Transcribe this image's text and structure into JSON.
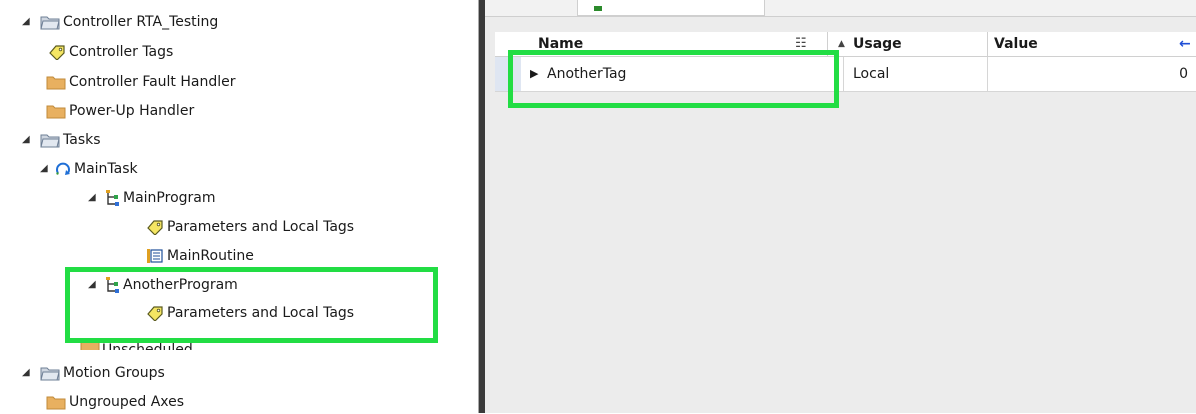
{
  "tree": {
    "items": [
      {
        "label": "Controller RTA_Testing",
        "icon": "folder-open-icon",
        "expander": "◢"
      },
      {
        "label": "Controller Tags",
        "icon": "tag-icon",
        "expander": ""
      },
      {
        "label": "Controller Fault Handler",
        "icon": "folder-icon",
        "expander": ""
      },
      {
        "label": "Power-Up Handler",
        "icon": "folder-icon",
        "expander": ""
      },
      {
        "label": "Tasks",
        "icon": "folder-open-icon",
        "expander": "◢"
      },
      {
        "label": "MainTask",
        "icon": "task-cycle-icon",
        "expander": "◢"
      },
      {
        "label": "MainProgram",
        "icon": "program-icon",
        "expander": "◢"
      },
      {
        "label": "Parameters and Local Tags",
        "icon": "tag-icon",
        "expander": ""
      },
      {
        "label": "MainRoutine",
        "icon": "routine-icon",
        "expander": ""
      },
      {
        "label": "AnotherProgram",
        "icon": "program-icon",
        "expander": "◢"
      },
      {
        "label": "Parameters and Local Tags",
        "icon": "tag-icon",
        "expander": ""
      },
      {
        "label": "Unscheduled",
        "icon": "folder-icon",
        "expander": ""
      },
      {
        "label": "Motion Groups",
        "icon": "folder-open-icon",
        "expander": "◢"
      },
      {
        "label": "Ungrouped Axes",
        "icon": "folder-icon",
        "expander": ""
      }
    ]
  },
  "grid": {
    "columns": {
      "name": "Name",
      "usage": "Usage",
      "value": "Value",
      "filter_glyph": "☷",
      "sort_glyph": "▲",
      "arrow_glyph": "←"
    },
    "rows": [
      {
        "expander": "▶",
        "name": "AnotherTag",
        "usage": "Local",
        "value": "0"
      }
    ]
  },
  "colors": {
    "highlight": "#22dd44",
    "tag_yellow": "#f5e663",
    "folder": "#e8b060",
    "accent_blue": "#1f4fd6"
  }
}
